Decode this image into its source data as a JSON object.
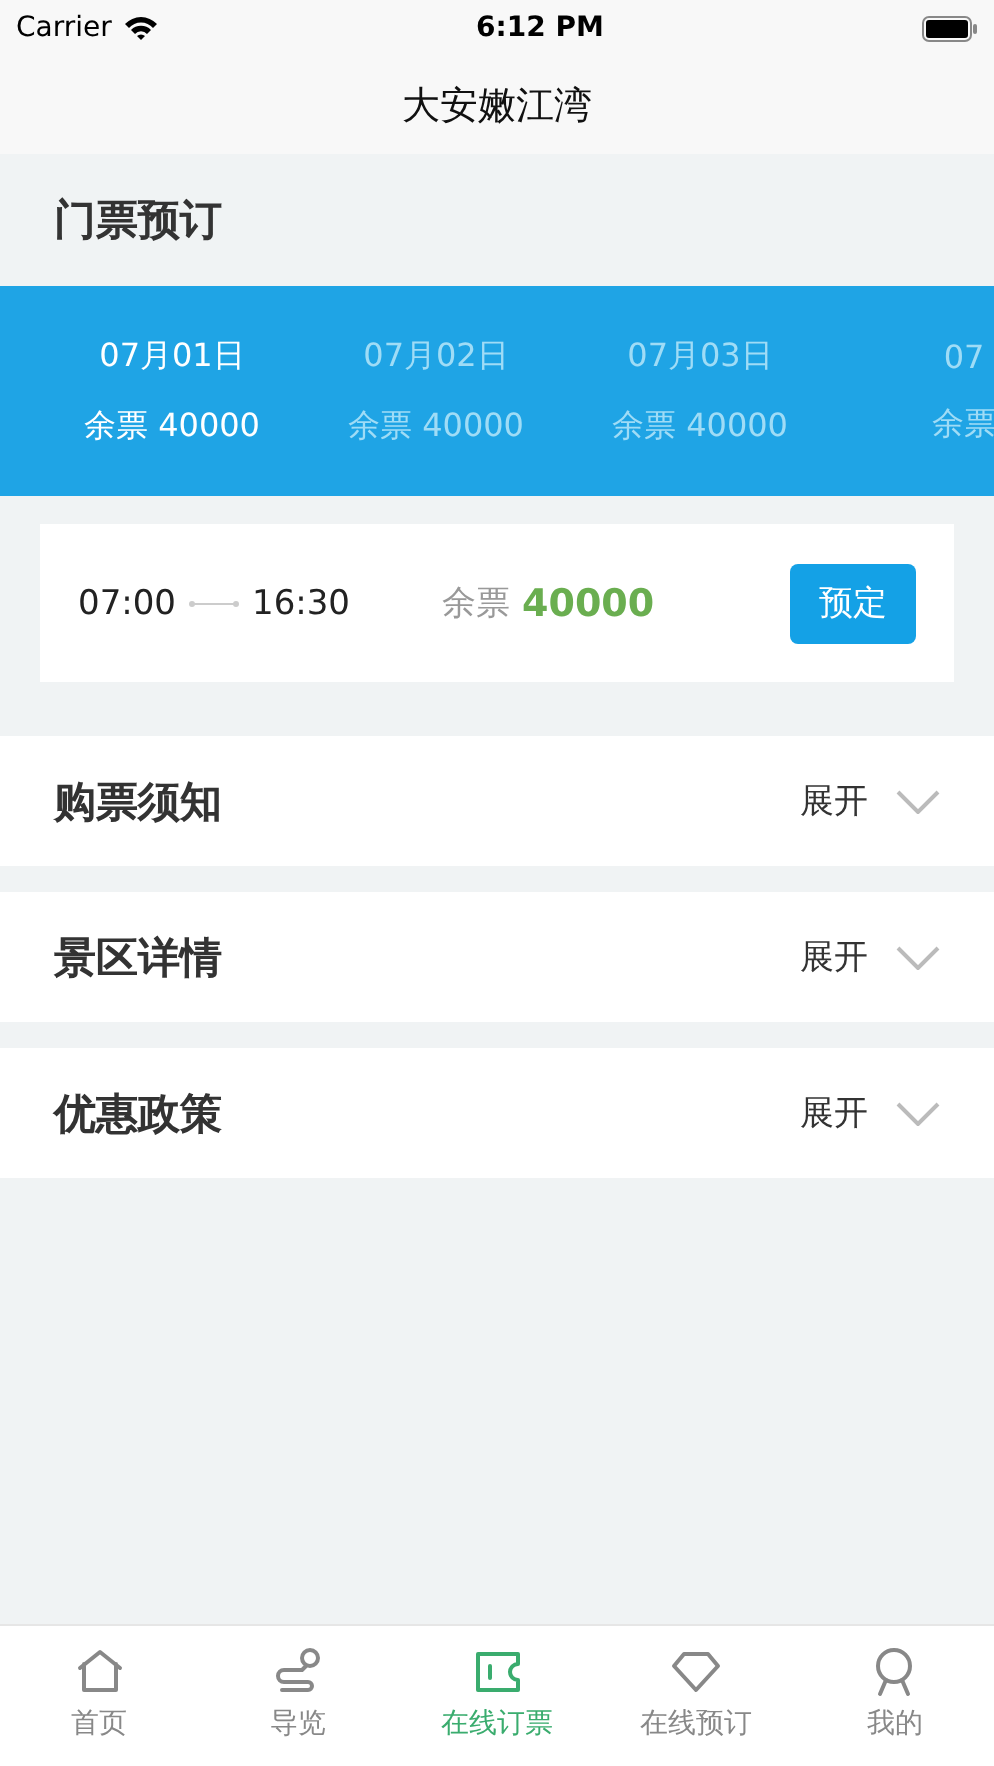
{
  "status_bar": {
    "carrier": "Carrier",
    "time": "6:12 PM"
  },
  "nav": {
    "title": "大安嫩江湾"
  },
  "section_title": "门票预订",
  "dates": [
    {
      "date": "07月01日",
      "remaining": "余票 40000",
      "selected": true
    },
    {
      "date": "07月02日",
      "remaining": "余票 40000",
      "selected": false
    },
    {
      "date": "07月03日",
      "remaining": "余票 40000",
      "selected": false
    },
    {
      "date": "07",
      "remaining": "余票",
      "selected": false
    }
  ],
  "session": {
    "start": "07:00",
    "end": "16:30",
    "remaining_label": "余票",
    "remaining_count": "40000",
    "button": "预定"
  },
  "accordions": [
    {
      "title": "购票须知",
      "toggle": "展开",
      "expanded": false
    },
    {
      "title": "景区详情",
      "toggle": "展开",
      "expanded": false
    },
    {
      "title": "优惠政策",
      "toggle": "展开",
      "expanded": false
    }
  ],
  "tabs": [
    {
      "label": "首页",
      "selected": false
    },
    {
      "label": "导览",
      "selected": false
    },
    {
      "label": "在线订票",
      "selected": true
    },
    {
      "label": "在线预订",
      "selected": false
    },
    {
      "label": "我的",
      "selected": false
    }
  ]
}
